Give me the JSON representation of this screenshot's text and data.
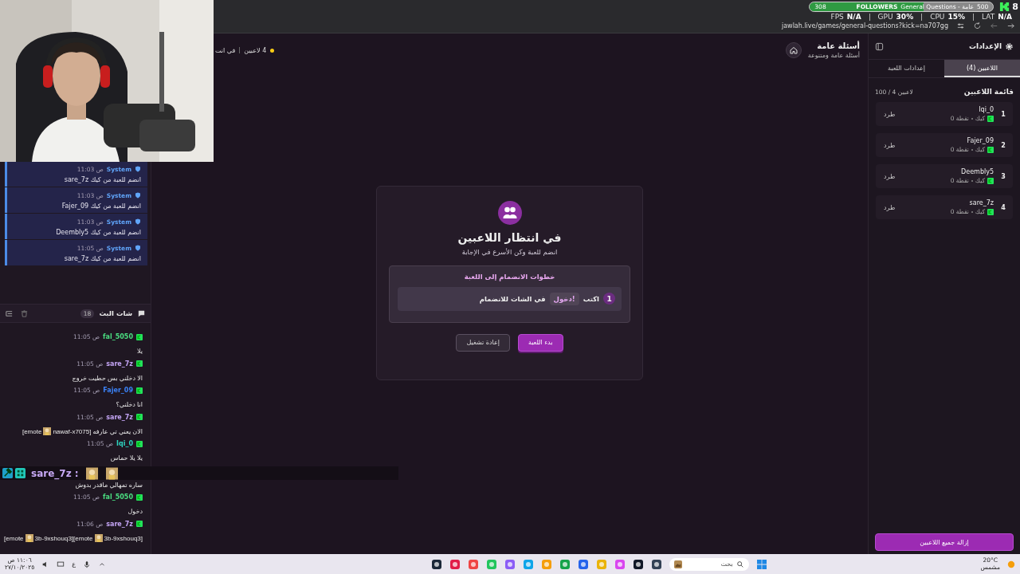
{
  "overlay": {
    "followers": {
      "current": "308",
      "label": "FOLLOWERS",
      "goal": "500",
      "level": 0.62
    },
    "stream_title": "General Questions - عامة",
    "viewer_count": "8",
    "stats": [
      {
        "label": "LAT",
        "value": "N/A"
      },
      {
        "label": "CPU",
        "value": "15%"
      },
      {
        "label": "GPU",
        "value": "30%"
      },
      {
        "label": "FPS",
        "value": "N/A"
      }
    ],
    "chat_banner": {
      "user": "sare_7z :"
    }
  },
  "browser": {
    "url": "jawlah.live/games/general-questions?kick=na707gg"
  },
  "chat": {
    "system_messages": [
      {
        "sender": "System",
        "time": "11:03 ص",
        "text": "sare_7z انضم للعبة من كيك"
      },
      {
        "sender": "System",
        "time": "11:03 ص",
        "text": "Fajer_09 انضم للعبة من كيك"
      },
      {
        "sender": "System",
        "time": "11:03 ص",
        "text": "Deembly5 انضم للعبة من كيك"
      },
      {
        "sender": "System",
        "time": "11:05 ص",
        "text": "sare_7z انضم للعبة من كيك"
      }
    ],
    "title": "شات البث",
    "count": "18",
    "messages": [
      {
        "user": "fal_5050",
        "color": "#4ade80",
        "time": "11:05 ص",
        "parts": [
          {
            "kind": "text",
            "text": "يلا"
          }
        ]
      },
      {
        "user": "sare_7z",
        "color": "#c4a5f5",
        "time": "11:05 ص",
        "parts": [
          {
            "kind": "text",
            "text": "الا دخلني بس حطيت خروج"
          }
        ]
      },
      {
        "user": "Fajer_09",
        "color": "#3b82f6",
        "time": "11:05 ص",
        "parts": [
          {
            "kind": "text",
            "text": "انا دخلني؟"
          }
        ]
      },
      {
        "user": "sare_7z",
        "color": "#c4a5f5",
        "time": "11:05 ص",
        "parts": [
          {
            "kind": "text",
            "text": "الان يعني تي عارفه"
          },
          {
            "kind": "text",
            "text": "nawaf-x7075]"
          },
          {
            "kind": "emote"
          },
          {
            "kind": "text",
            "text": "[emote"
          }
        ]
      },
      {
        "user": "Iqi_0",
        "color": "#2dd4bf",
        "time": "11:05 ص",
        "parts": [
          {
            "kind": "text",
            "text": "يلا يلا حماس"
          }
        ]
      },
      {
        "parts": [
          {
            "kind": "text",
            "text": "ساره تمهالي ماقدر بدوش"
          }
        ]
      },
      {
        "user": "fal_5050",
        "color": "#4ade80",
        "time": "11:05 ص",
        "parts": [
          {
            "kind": "text",
            "text": "دخول"
          }
        ]
      },
      {
        "user": "sare_7z",
        "color": "#c4a5f5",
        "time": "11:06 ص",
        "parts": [
          {
            "kind": "text",
            "text": "3b-9xshouq3]"
          },
          {
            "kind": "emote"
          },
          {
            "kind": "text",
            "text": "3b-9xshouq3][emote"
          },
          {
            "kind": "emote"
          },
          {
            "kind": "text",
            "text": "[emote"
          }
        ]
      }
    ]
  },
  "game_header": {
    "title": "أسئلة عامة",
    "subtitle": "أسئلة عامة ومتنوعة",
    "players": "4 لاعبين",
    "status": "في انت"
  },
  "modal": {
    "title": "في انتظار اللاعبين",
    "subtitle": "انضم للعبة وكن الأسرع في الإجابة",
    "steps_title": "خطوات الانضمام إلى اللعبة",
    "steps": [
      {
        "number": "1",
        "before": "اكتب",
        "command": "!دخول",
        "after": "في الشات للانضمام"
      }
    ],
    "buttons": [
      {
        "label": "بدء اللعبة",
        "kind": "primary"
      },
      {
        "label": "إعادة تشغيل",
        "kind": "secondary"
      }
    ]
  },
  "settings": {
    "title": "الإعدادات",
    "tabs": [
      {
        "label": "اللاعبين (4)",
        "selected": true
      },
      {
        "label": "إعدادات اللعبة",
        "selected": false
      }
    ],
    "list_title": "قائمة اللاعبين",
    "list_count": "100 / 4 لاعبين",
    "players": [
      {
        "rank": "1",
        "name": "Iqi_0",
        "platform": "كيك",
        "points": "0 نقطة",
        "action": "طرد"
      },
      {
        "rank": "2",
        "name": "Fajer_09",
        "platform": "كيك",
        "points": "0 نقطة",
        "action": "طرد"
      },
      {
        "rank": "3",
        "name": "Deembly5",
        "platform": "كيك",
        "points": "0 نقطة",
        "action": "طرد"
      },
      {
        "rank": "4",
        "name": "sare_7z",
        "platform": "كيك",
        "points": "0 نقطة",
        "action": "طرد"
      }
    ],
    "remove_all": "إزالة جميع اللاعبين"
  },
  "taskbar": {
    "time": "١١:٠٦ ص",
    "date": "٢٧/١٠/٢٠٢٥",
    "language": "ع",
    "search": "بحث",
    "temperature": "20°C",
    "weather": "مشمس"
  }
}
